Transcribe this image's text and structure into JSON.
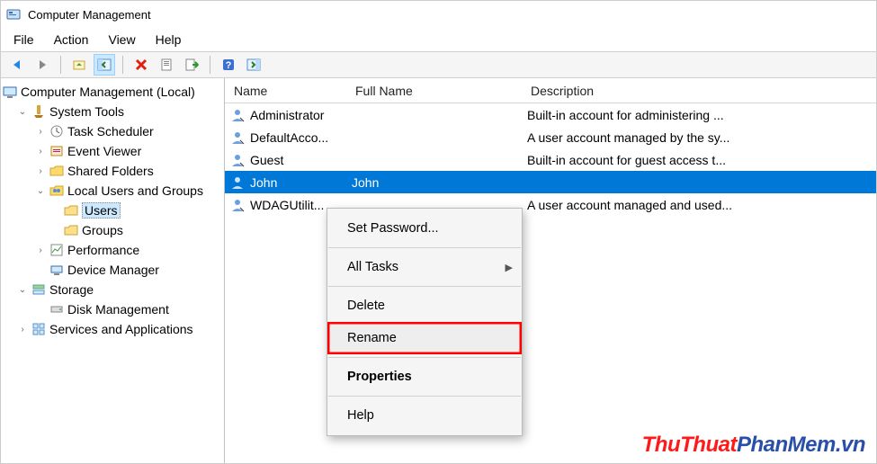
{
  "window": {
    "title": "Computer Management"
  },
  "menu": {
    "file": "File",
    "action": "Action",
    "view": "View",
    "help": "Help"
  },
  "tree": {
    "root": "Computer Management (Local)",
    "system": "System Tools",
    "task": "Task Scheduler",
    "event": "Event Viewer",
    "shared": "Shared Folders",
    "localug": "Local Users and Groups",
    "users": "Users",
    "groups": "Groups",
    "perf": "Performance",
    "devmgr": "Device Manager",
    "storage": "Storage",
    "diskmgmt": "Disk Management",
    "svcapp": "Services and Applications"
  },
  "columns": {
    "name": "Name",
    "full": "Full Name",
    "desc": "Description"
  },
  "rows": [
    {
      "name": "Administrator",
      "full": "",
      "desc": "Built-in account for administering ..."
    },
    {
      "name": "DefaultAcco...",
      "full": "",
      "desc": "A user account managed by the sy..."
    },
    {
      "name": "Guest",
      "full": "",
      "desc": "Built-in account for guest access t..."
    },
    {
      "name": "John",
      "full": "John",
      "desc": ""
    },
    {
      "name": "WDAGUtilit...",
      "full": "",
      "desc": "A user account managed and used..."
    }
  ],
  "ctx": {
    "setpwd": "Set Password...",
    "alltasks": "All Tasks",
    "delete": "Delete",
    "rename": "Rename",
    "properties": "Properties",
    "help": "Help"
  },
  "watermark": {
    "a": "ThuThuat",
    "b": "PhanMem",
    "c": ".vn"
  }
}
